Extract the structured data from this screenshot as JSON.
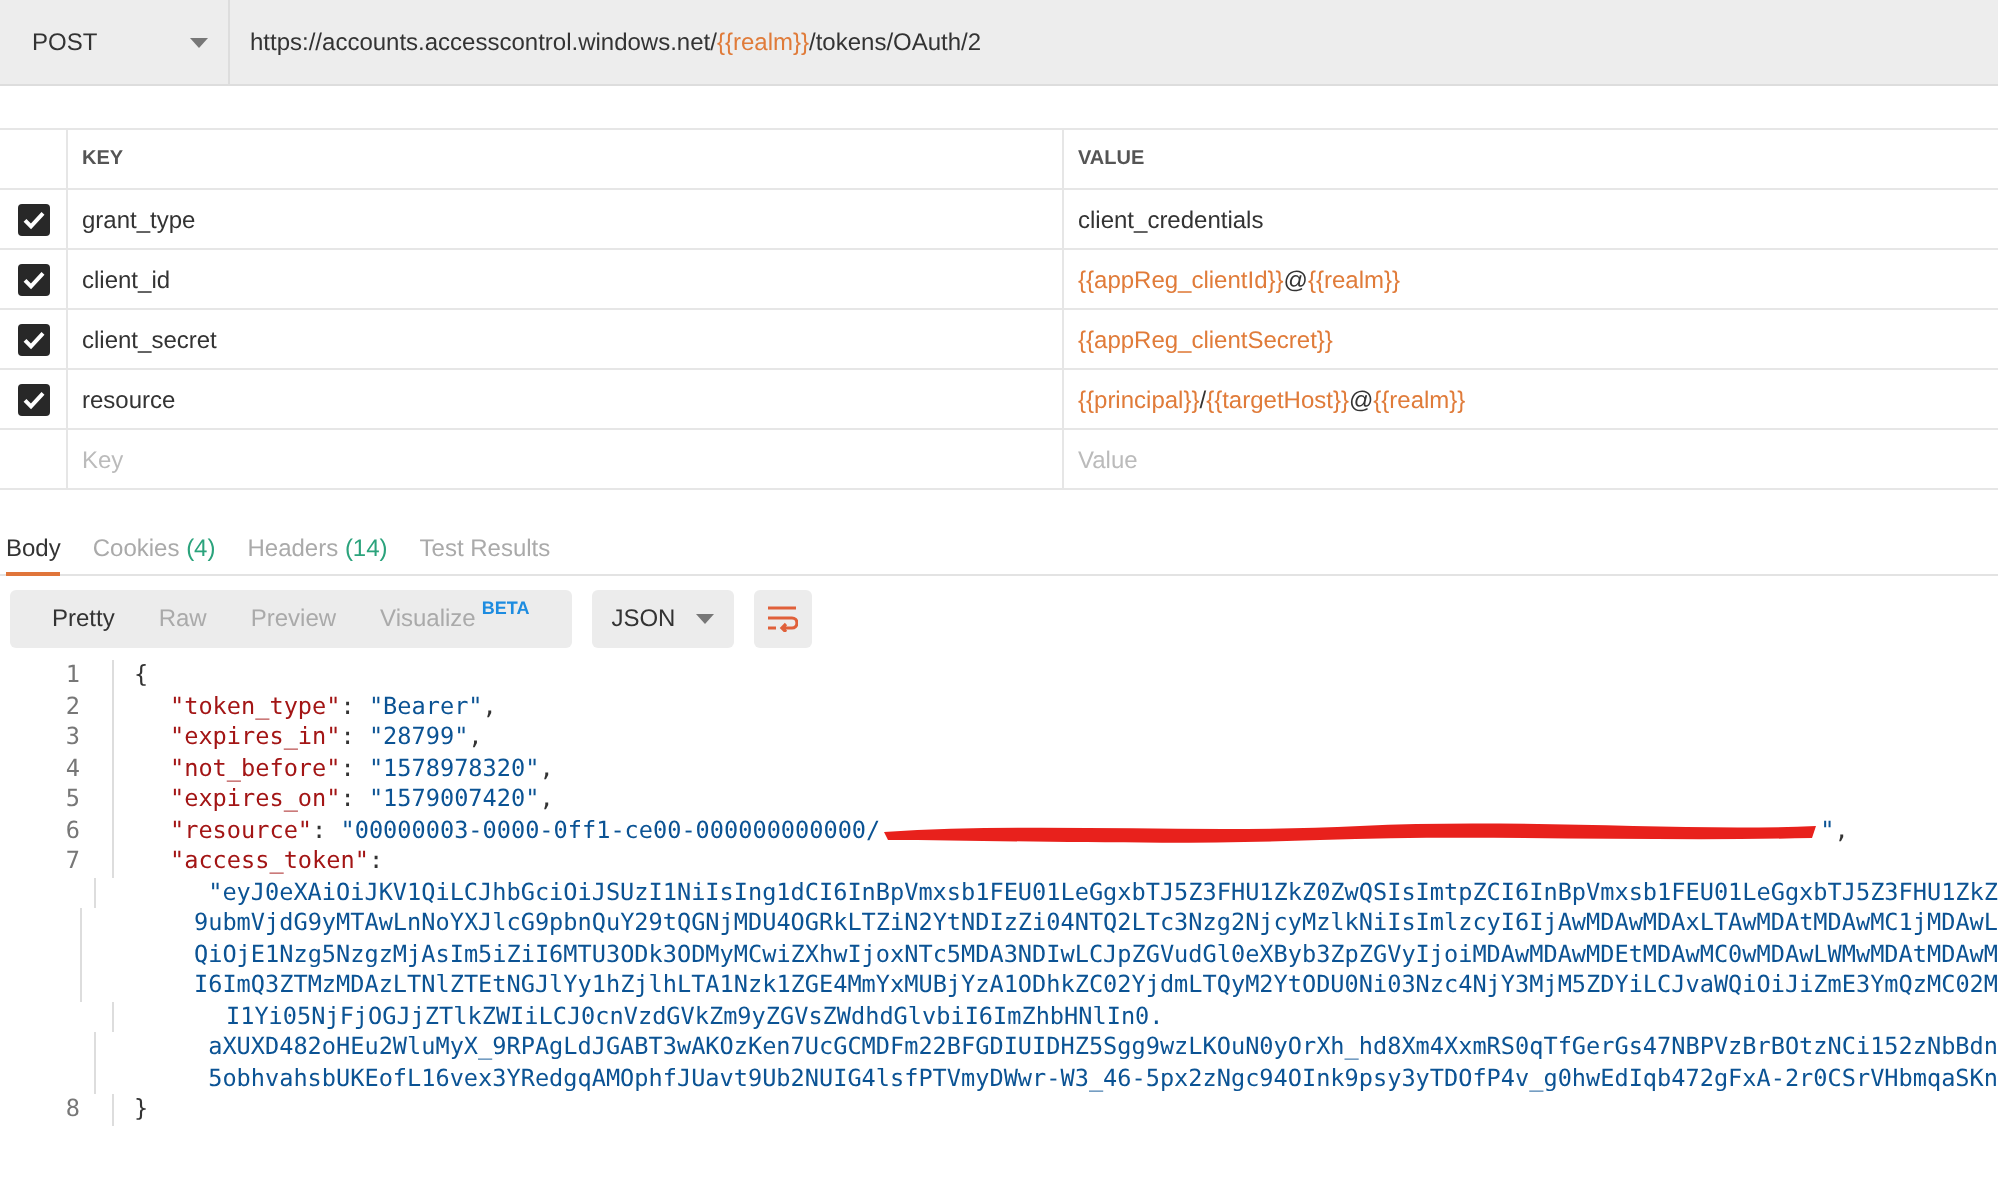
{
  "request": {
    "method": "POST",
    "url": [
      {
        "kind": "plain",
        "text": "https://accounts.accesscontrol.windows.net/"
      },
      {
        "kind": "variable",
        "text": "{{realm}}"
      },
      {
        "kind": "plain",
        "text": "/tokens/OAuth/2"
      }
    ]
  },
  "params": {
    "columns": [
      "KEY",
      "VALUE"
    ],
    "rows": [
      {
        "checked": true,
        "key": "grant_type",
        "value": [
          {
            "kind": "plain",
            "text": "client_credentials"
          }
        ]
      },
      {
        "checked": true,
        "key": "client_id",
        "value": [
          {
            "kind": "variable",
            "text": "{{appReg_clientId}}"
          },
          {
            "kind": "plain",
            "text": "@"
          },
          {
            "kind": "variable",
            "text": "{{realm}}"
          }
        ]
      },
      {
        "checked": true,
        "key": "client_secret",
        "value": [
          {
            "kind": "variable",
            "text": "{{appReg_clientSecret}}"
          }
        ]
      },
      {
        "checked": true,
        "key": "resource",
        "value": [
          {
            "kind": "variable",
            "text": "{{principal}}"
          },
          {
            "kind": "plain",
            "text": "/"
          },
          {
            "kind": "variable",
            "text": "{{targetHost}}"
          },
          {
            "kind": "plain",
            "text": "@"
          },
          {
            "kind": "variable",
            "text": "{{realm}}"
          }
        ]
      }
    ],
    "new_row": {
      "key_placeholder": "Key",
      "value_placeholder": "Value"
    }
  },
  "response_tabs": [
    {
      "label": "Body",
      "selected": true
    },
    {
      "label": "Cookies",
      "count": "(4)",
      "selected": false
    },
    {
      "label": "Headers",
      "count": "(14)",
      "selected": false
    },
    {
      "label": "Test Results",
      "selected": false
    }
  ],
  "view_modes": [
    {
      "label": "Pretty",
      "selected": true
    },
    {
      "label": "Raw",
      "selected": false
    },
    {
      "label": "Preview",
      "selected": false
    },
    {
      "label": "Visualize",
      "badge": "BETA",
      "selected": false
    }
  ],
  "format": "JSON",
  "code": [
    {
      "number": "1",
      "kind": "brace",
      "segments": [
        {
          "kind": "punct",
          "text": "{"
        }
      ]
    },
    {
      "number": "2",
      "kind": "member",
      "segments": [
        {
          "kind": "key",
          "text": "\"token_type\""
        },
        {
          "kind": "punct",
          "text": ": "
        },
        {
          "kind": "string",
          "text": "\"Bearer\""
        },
        {
          "kind": "punct",
          "text": ","
        }
      ]
    },
    {
      "number": "3",
      "kind": "member",
      "segments": [
        {
          "kind": "key",
          "text": "\"expires_in\""
        },
        {
          "kind": "punct",
          "text": ": "
        },
        {
          "kind": "string",
          "text": "\"28799\""
        },
        {
          "kind": "punct",
          "text": ","
        }
      ]
    },
    {
      "number": "4",
      "kind": "member",
      "segments": [
        {
          "kind": "key",
          "text": "\"not_before\""
        },
        {
          "kind": "punct",
          "text": ": "
        },
        {
          "kind": "string",
          "text": "\"1578978320\""
        },
        {
          "kind": "punct",
          "text": ","
        }
      ]
    },
    {
      "number": "5",
      "kind": "member",
      "segments": [
        {
          "kind": "key",
          "text": "\"expires_on\""
        },
        {
          "kind": "punct",
          "text": ": "
        },
        {
          "kind": "string",
          "text": "\"1579007420\""
        },
        {
          "kind": "punct",
          "text": ","
        }
      ]
    },
    {
      "number": "6",
      "kind": "member",
      "segments": [
        {
          "kind": "key",
          "text": "\"resource\""
        },
        {
          "kind": "punct",
          "text": ": "
        },
        {
          "kind": "string",
          "text": "\"00000003-0000-0ff1-ce00-000000000000/"
        },
        {
          "kind": "redaction"
        },
        {
          "kind": "string",
          "text": "\""
        },
        {
          "kind": "punct",
          "text": ","
        }
      ]
    },
    {
      "number": "7",
      "kind": "member",
      "segments": [
        {
          "kind": "key",
          "text": "\"access_token\""
        },
        {
          "kind": "punct",
          "text": ":"
        }
      ],
      "wrapped": [
        "\"eyJ0eXAiOiJKV1QiLCJhbGciOiJSUzI1NiIsIng1dCI6InBpVmxsb1FEU01LeGgxbTJ5Z3FHU1ZkZ0ZwQSIsImtpZCI6InBpVmxsb1FEU01LeGgxbTJ5Z3FHU1ZkZ",
        "9ubmVjdG9yMTAwLnNoYXJlcG9pbnQuY29tQGNjMDU4OGRkLTZiN2YtNDIzZi04NTQ2LTc3Nzg2NjcyMzlkNiIsImlzcyI6IjAwMDAwMDAxLTAwMDAtMDAwMC1jMDAwL",
        "QiOjE1Nzg5NzgzMjAsIm5iZiI6MTU3ODk3ODMyMCwiZXhwIjoxNTc5MDA3NDIwLCJpZGVudGl0eXByb3ZpZGVyIjoiMDAwMDAwMDEtMDAwMC0wMDAwLWMwMDAtMDAwM",
        "I6ImQ3ZTMzMDAzLTNlZTEtNGJlYy1hZjlhLTA1Nzk1ZGE4MmYxMUBjYzA1ODhkZC02YjdmLTQyM2YtODU0Ni03Nzc4NjY3MjM5ZDYiLCJvaWQiOiJiZmE3YmQzMC02M",
        "I1Yi05NjFjOGJjZTlkZWIiLCJ0cnVzdGVkZm9yZGVsZWdhdGlvbiI6ImZhbHNlIn0.",
        "aXUXD482oHEu2WluMyX_9RPAgLdJGABT3wAKOzKen7UcGCMDFm22BFGDIUIDHZ5Sgg9wzLKOuN0yOrXh_hd8Xm4XxmRS0qTfGerGs47NBPVzBrBOtzNCi152zNbBdn",
        "5obhvahsbUKEofL16vex3YRedgqAMOphfJUavt9Ub2NUIG4lsfPTVmyDWwr-W3_46-5px2zNgc94OInk9psy3yTDOfP4v_g0hwEdIqb472gFxA-2r0CSrVHbmqaSKn"
      ]
    },
    {
      "number": "8",
      "kind": "brace",
      "segments": [
        {
          "kind": "punct",
          "text": "}"
        }
      ]
    }
  ]
}
